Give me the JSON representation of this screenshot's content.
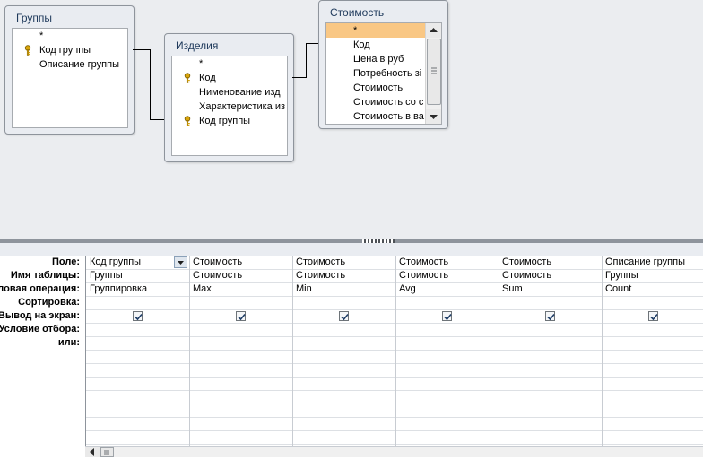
{
  "tables": {
    "groups": {
      "title": "Группы",
      "fields": [
        "*",
        "Код группы",
        "Описание группы"
      ]
    },
    "products": {
      "title": "Изделия",
      "fields": [
        "*",
        "Код",
        "Нименование изд",
        "Характеристика из",
        "Код группы"
      ]
    },
    "cost": {
      "title": "Стоимость",
      "fields": [
        "*",
        "Код",
        "Цена в руб",
        "Потребность зі",
        "Стоимость",
        "Стоимость со с",
        "Стоимость в ва"
      ]
    }
  },
  "grid": {
    "row_labels": [
      "Поле:",
      "Имя таблицы:",
      "ловая операция:",
      "Сортировка:",
      "Вывод на экран:",
      "Условие отбора:",
      "или:"
    ],
    "columns": [
      {
        "field": "Код группы",
        "table": "Группы",
        "total": "Группировка",
        "show": true
      },
      {
        "field": "Стоимость",
        "table": "Стоимость",
        "total": "Max",
        "show": true
      },
      {
        "field": "Стоимость",
        "table": "Стоимость",
        "total": "Min",
        "show": true
      },
      {
        "field": "Стоимость",
        "table": "Стоимость",
        "total": "Avg",
        "show": true
      },
      {
        "field": "Стоимость",
        "table": "Стоимость",
        "total": "Sum",
        "show": true
      },
      {
        "field": "Описание группы",
        "table": "Группы",
        "total": "Count",
        "show": true
      }
    ]
  },
  "icons": {
    "key": "key-icon",
    "dropdown": "chevron-down-icon",
    "check": "checkmark-icon"
  },
  "colors": {
    "selected_row": "#f9c784",
    "title_text": "#1e395b",
    "pane_bg": "#ebedf0"
  }
}
